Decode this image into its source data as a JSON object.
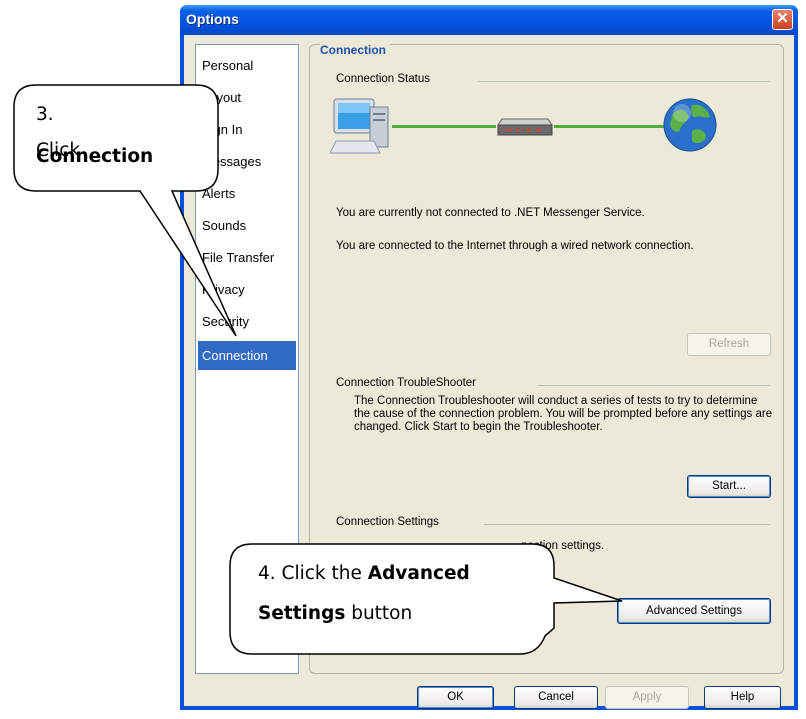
{
  "window": {
    "title": "Options",
    "close_glyph": "✕"
  },
  "nav": {
    "items": [
      {
        "label": "Personal"
      },
      {
        "label": "Layout"
      },
      {
        "label": "Sign In"
      },
      {
        "label": "Messages"
      },
      {
        "label": "Alerts"
      },
      {
        "label": "Sounds"
      },
      {
        "label": "File Transfer"
      },
      {
        "label": "Privacy"
      },
      {
        "label": "Security"
      },
      {
        "label": "Connection"
      }
    ],
    "selected": "Connection"
  },
  "panel": {
    "header": "Connection",
    "status": {
      "label": "Connection Status",
      "messenger_text": "You are currently not connected to .NET Messenger Service.",
      "internet_text": "You are connected to the Internet through a wired network connection.",
      "refresh_label": "Refresh",
      "icons": [
        "computer-icon",
        "network-hub-icon",
        "globe-icon"
      ]
    },
    "troubleshooter": {
      "label": "Connection TroubleShooter",
      "text": "The Connection Troubleshooter will conduct a series of tests to try to determine the cause of the connection problem. You will be prompted before any settings are changed. Click Start to begin the Troubleshooter.",
      "start_label": "Start..."
    },
    "settings": {
      "label": "Connection Settings",
      "text_visible": "nection settings.",
      "advanced_label": "Advanced Settings"
    }
  },
  "footer": {
    "ok_label": "OK",
    "cancel_label": "Cancel",
    "apply_label": "Apply",
    "help_label": "Help"
  },
  "callouts": {
    "step3": {
      "line1": "3. Click",
      "bold": "Connection"
    },
    "step4": {
      "prefix": "4. Click the ",
      "bold1": "Advanced",
      "bold2": "Settings",
      "suffix": " button"
    }
  },
  "colors": {
    "title_blue": "#0554e0",
    "selection_blue": "#316ac5",
    "header_blue": "#1d4faa",
    "link_line_green": "#4fb03e"
  }
}
